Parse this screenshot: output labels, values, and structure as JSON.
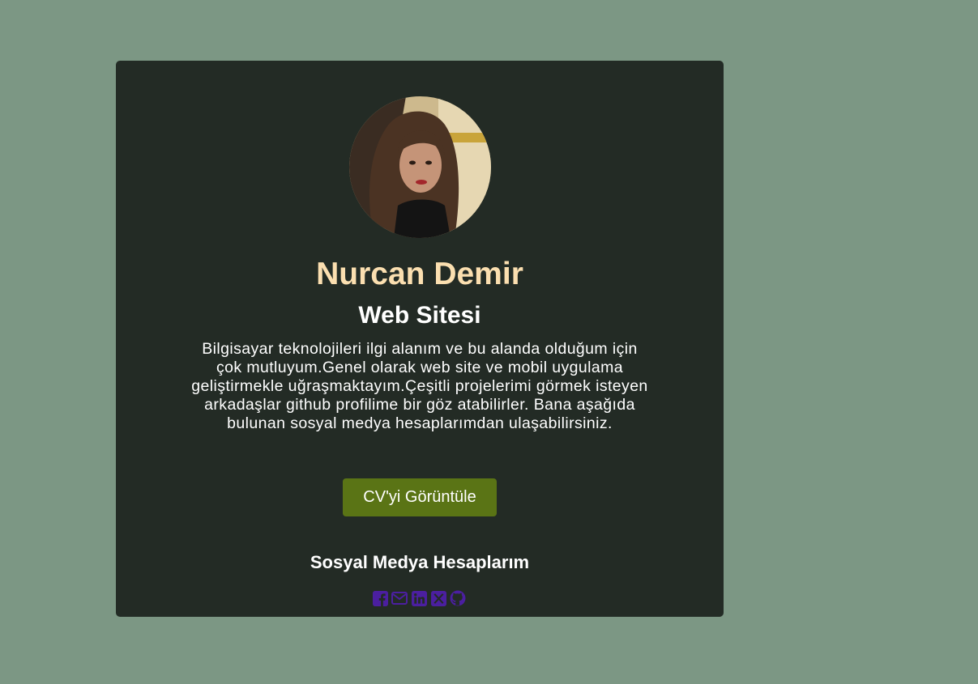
{
  "profile": {
    "name": "Nurcan Demir",
    "subtitle": "Web Sitesi",
    "bio": "Bilgisayar teknolojileri ilgi alanım ve bu alanda olduğum için çok mutluyum.Genel olarak web site ve mobil uygulama geliştirmekle uğraşmaktayım.Çeşitli projelerimi görmek isteyen arkadaşlar github profilime bir göz atabilirler. Bana aşağıda bulunan sosyal medya hesaplarımdan ulaşabilirsiniz.",
    "cv_button_label": "CV'yi Görüntüle"
  },
  "social": {
    "title": "Sosyal Medya Hesaplarım",
    "icons": [
      "facebook-icon",
      "mail-icon",
      "linkedin-icon",
      "x-twitter-icon",
      "github-icon"
    ],
    "icon_color": "#4b1fa0"
  },
  "colors": {
    "page_background": "#7c9784",
    "card_background": "#232b25",
    "name_color": "#fbdfb0",
    "button_background": "#5a7415"
  }
}
